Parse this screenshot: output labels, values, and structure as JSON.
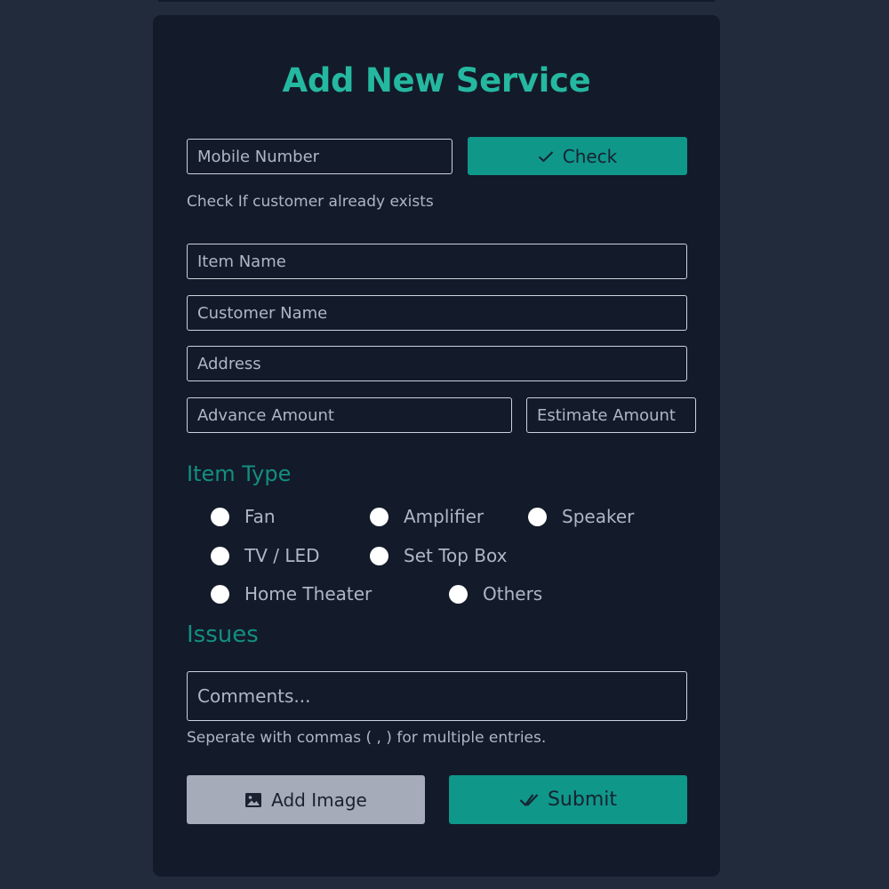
{
  "form": {
    "title": "Add New Service",
    "mobile": {
      "placeholder": "Mobile Number"
    },
    "check_button": {
      "label": "Check",
      "icon": "check-icon"
    },
    "check_hint": "Check If customer already exists",
    "item_name": {
      "placeholder": "Item Name"
    },
    "customer_name": {
      "placeholder": "Customer Name"
    },
    "address": {
      "placeholder": "Address"
    },
    "advance_amount": {
      "placeholder": "Advance Amount"
    },
    "estimate_amount": {
      "placeholder": "Estimate Amount"
    },
    "item_type": {
      "heading": "Item Type",
      "options": [
        "Fan",
        "Amplifier",
        "Speaker",
        "TV / LED",
        "Set Top Box",
        "Home Theater",
        "Others"
      ]
    },
    "issues": {
      "heading": "Issues",
      "placeholder": "Comments...",
      "hint": "Seperate with commas ( , ) for multiple entries."
    },
    "add_image_button": {
      "label": "Add Image",
      "icon": "image-icon"
    },
    "submit_button": {
      "label": "Submit",
      "icon": "double-check-icon"
    }
  },
  "colors": {
    "background": "#222b3b",
    "card": "#131a29",
    "accent": "#25b8a0",
    "button_teal": "#0f978a",
    "button_gray": "#a5abb8",
    "text_muted": "#aeb7c4"
  }
}
